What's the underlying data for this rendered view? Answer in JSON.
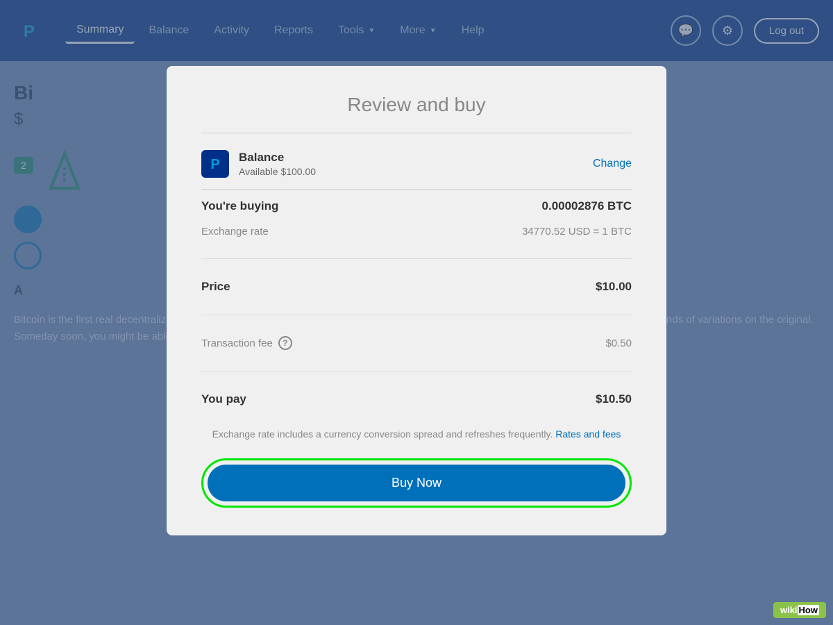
{
  "navbar": {
    "logo_alt": "PayPal",
    "links": [
      {
        "label": "Summary",
        "active": true
      },
      {
        "label": "Balance",
        "active": false
      },
      {
        "label": "Activity",
        "active": false
      },
      {
        "label": "Reports",
        "active": false
      },
      {
        "label": "Tools",
        "active": false,
        "has_arrow": true
      },
      {
        "label": "More",
        "active": false,
        "has_arrow": true
      },
      {
        "label": "Help",
        "active": false
      }
    ],
    "icons": {
      "message": "💬",
      "settings": "⚙"
    },
    "logout_label": "Log out"
  },
  "background": {
    "title_partial": "Bi",
    "price_partial": "$",
    "badge": "2",
    "body_text": "Bitcoin is the first real decentralized digital currency. It is comonly used as cash and credit. It set off a revolution that has since inspired thousands of variations on the original. Someday soon, you might be able to buy just about anything and send money to anyone using bitcoins and other"
  },
  "modal": {
    "title": "Review and buy",
    "payment_method": {
      "label": "Balance",
      "sublabel": "Available $100.00",
      "change_label": "Change"
    },
    "rows": {
      "buying_label": "You're buying",
      "buying_value": "0.00002876 BTC",
      "exchange_rate_label": "Exchange rate",
      "exchange_rate_value": "34770.52 USD = 1 BTC",
      "price_label": "Price",
      "price_value": "$10.00",
      "fee_label": "Transaction fee",
      "fee_value": "$0.50",
      "you_pay_label": "You pay",
      "you_pay_value": "$10.50"
    },
    "exchange_note": "Exchange rate includes a currency conversion spread and refreshes frequently.",
    "rates_fees_link": "Rates and fees",
    "buy_now_label": "Buy Now"
  },
  "wikihow": {
    "label": "wikiHow"
  }
}
